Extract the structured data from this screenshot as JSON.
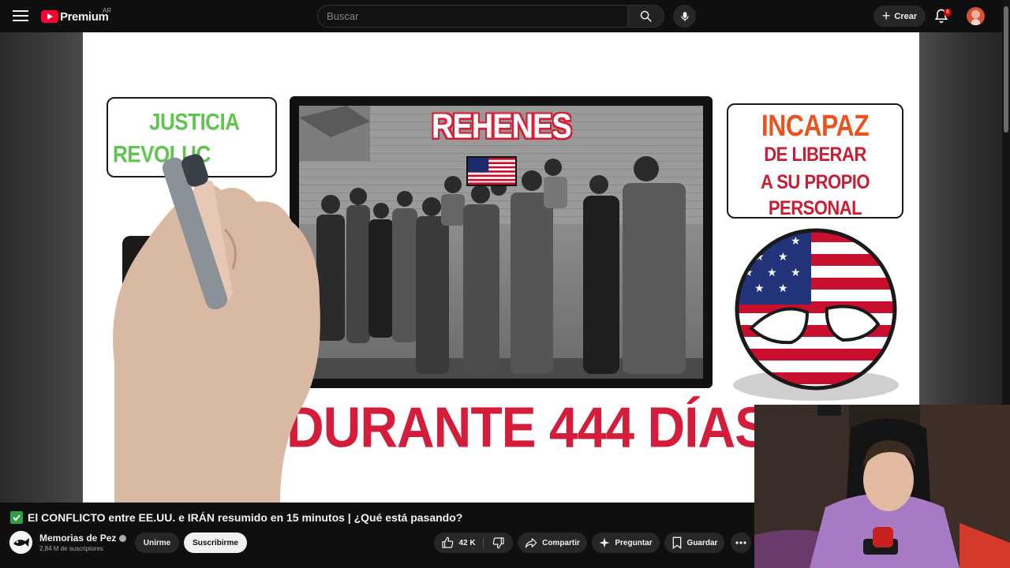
{
  "header": {
    "logo_text": "Premium",
    "country_code": "AR",
    "search_placeholder": "Buscar",
    "create_label": "Crear",
    "notification_count": "8"
  },
  "video_frame": {
    "left_note_line1": "JUSTICIA",
    "left_note_line2": "REVOLUC",
    "photo_caption": "REHENES",
    "right_note_title": "INCAPAZ",
    "right_note_line1": "DE LIBERAR",
    "right_note_line2": "A SU PROPIO",
    "right_note_line3": "PERSONAL",
    "bottom_caption": "DURANTE 444 DÍAS"
  },
  "video_info": {
    "title": "El CONFLICTO entre EE.UU. e IRÁN resumido en 15 minutos | ¿Qué está pasando?",
    "channel_name": "Memorias de Pez",
    "subscribers": "2,84 M de suscriptores",
    "join_label": "Unirme",
    "subscribe_label": "Suscribirme",
    "like_count": "42 K",
    "share_label": "Compartir",
    "ask_label": "Preguntar",
    "save_label": "Guardar"
  },
  "colors": {
    "background": "#0f0f0f",
    "brand_red": "#ff0033",
    "green_text": "#61c44f",
    "orange_text": "#e8541f",
    "caption_red": "#d41d3b"
  }
}
